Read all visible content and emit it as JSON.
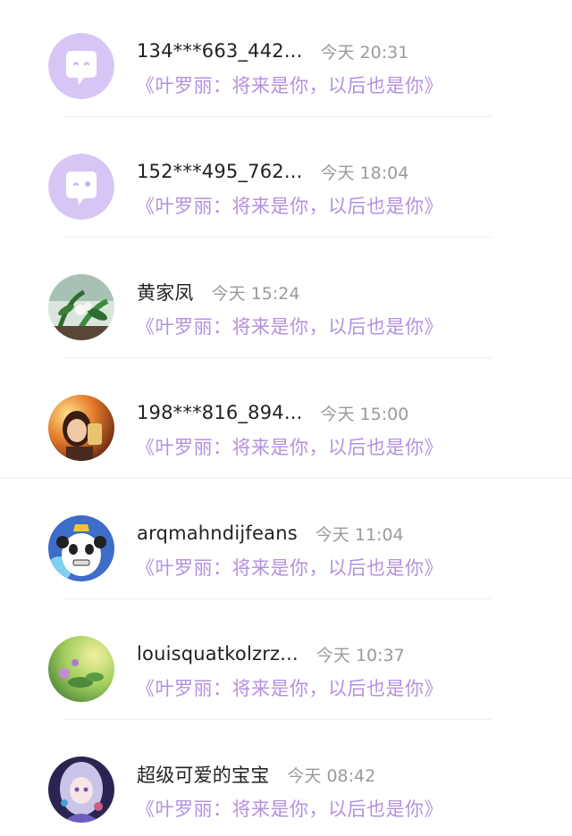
{
  "colors": {
    "comment": "#b491e0",
    "name": "#222222",
    "time": "#9a9a9a",
    "default_avatar_bg": "#d7c6f5"
  },
  "comments": [
    {
      "name": "134***663_442...",
      "time": "今天 20:31",
      "comment": "《叶罗丽：将来是你，以后也是你》",
      "avatar": "default-avatar-icon"
    },
    {
      "name": "152***495_762...",
      "time": "今天 18:04",
      "comment": "《叶罗丽：将来是你，以后也是你》",
      "avatar": "default-avatar-icon"
    },
    {
      "name": "黄家凤",
      "time": "今天 15:24",
      "comment": "《叶罗丽：将来是你，以后也是你》",
      "avatar": "plant-photo"
    },
    {
      "name": "198***816_894...",
      "time": "今天 15:00",
      "comment": "《叶罗丽：将来是你，以后也是你》",
      "avatar": "selfie-photo"
    },
    {
      "name": "arqmahndijfeans",
      "time": "今天 11:04",
      "comment": "《叶罗丽：将来是你，以后也是你》",
      "avatar": "panda-cartoon"
    },
    {
      "name": "louisquatkolzrz...",
      "time": "今天 10:37",
      "comment": "《叶罗丽：将来是你，以后也是你》",
      "avatar": "flower-photo"
    },
    {
      "name": "超级可爱的宝宝",
      "time": "今天 08:42",
      "comment": "《叶罗丽：将来是你，以后也是你》",
      "avatar": "anime-girl"
    }
  ]
}
